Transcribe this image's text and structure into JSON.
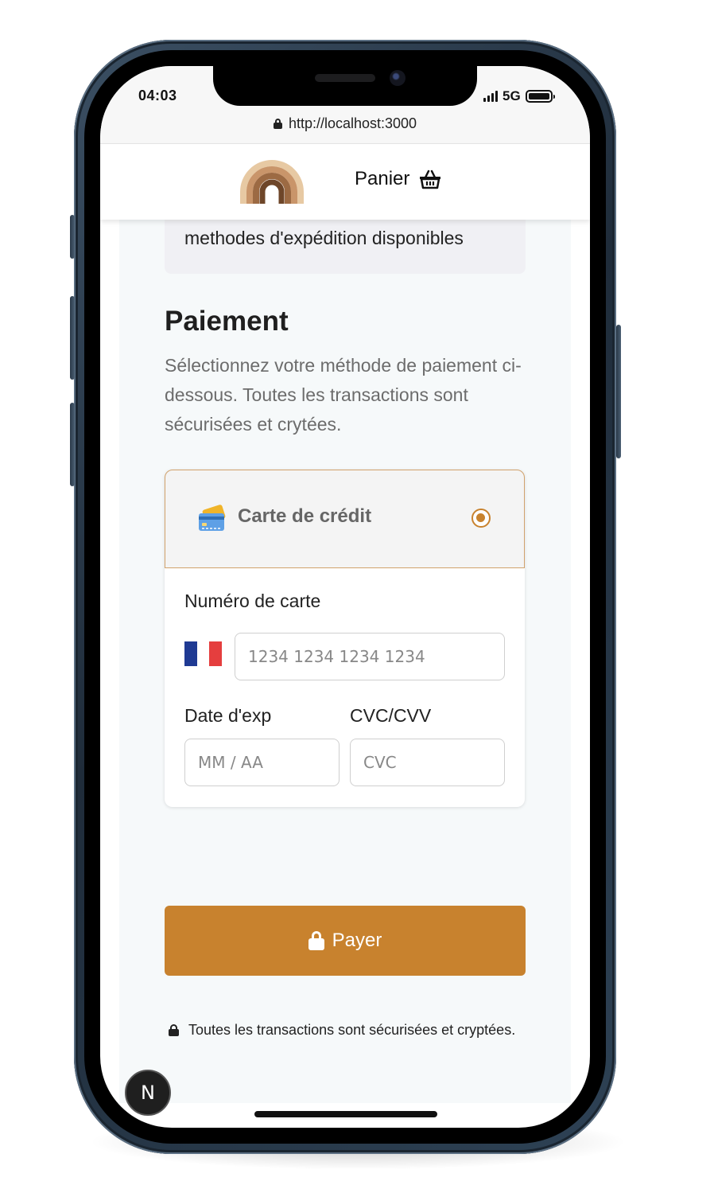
{
  "status_bar": {
    "time": "04:03",
    "network": "5G"
  },
  "browser": {
    "url": "http://localhost:3000"
  },
  "header": {
    "cart_label": "Panier"
  },
  "shipping": {
    "text": "methodes d'expédition disponibles"
  },
  "payment": {
    "title": "Paiement",
    "description": "Sélectionnez votre méthode de paiement ci-dessous. Toutes les transactions sont sécurisées et crytées.",
    "method_label": "Carte de crédit",
    "card_number_label": "Numéro de carte",
    "card_number_placeholder": "1234 1234 1234 1234",
    "expiry_label": "Date d'exp",
    "expiry_placeholder": "MM / AA",
    "cvc_label": "CVC/CVV",
    "cvc_placeholder": "CVC",
    "pay_button": "Payer",
    "secure_note": "Toutes les transactions sont sécurisées et cryptées."
  },
  "dev_badge": {
    "letter": "N"
  },
  "colors": {
    "accent": "#c8822e",
    "flag_blue": "#1f3a93",
    "flag_white": "#ffffff",
    "flag_red": "#e53e3e"
  }
}
